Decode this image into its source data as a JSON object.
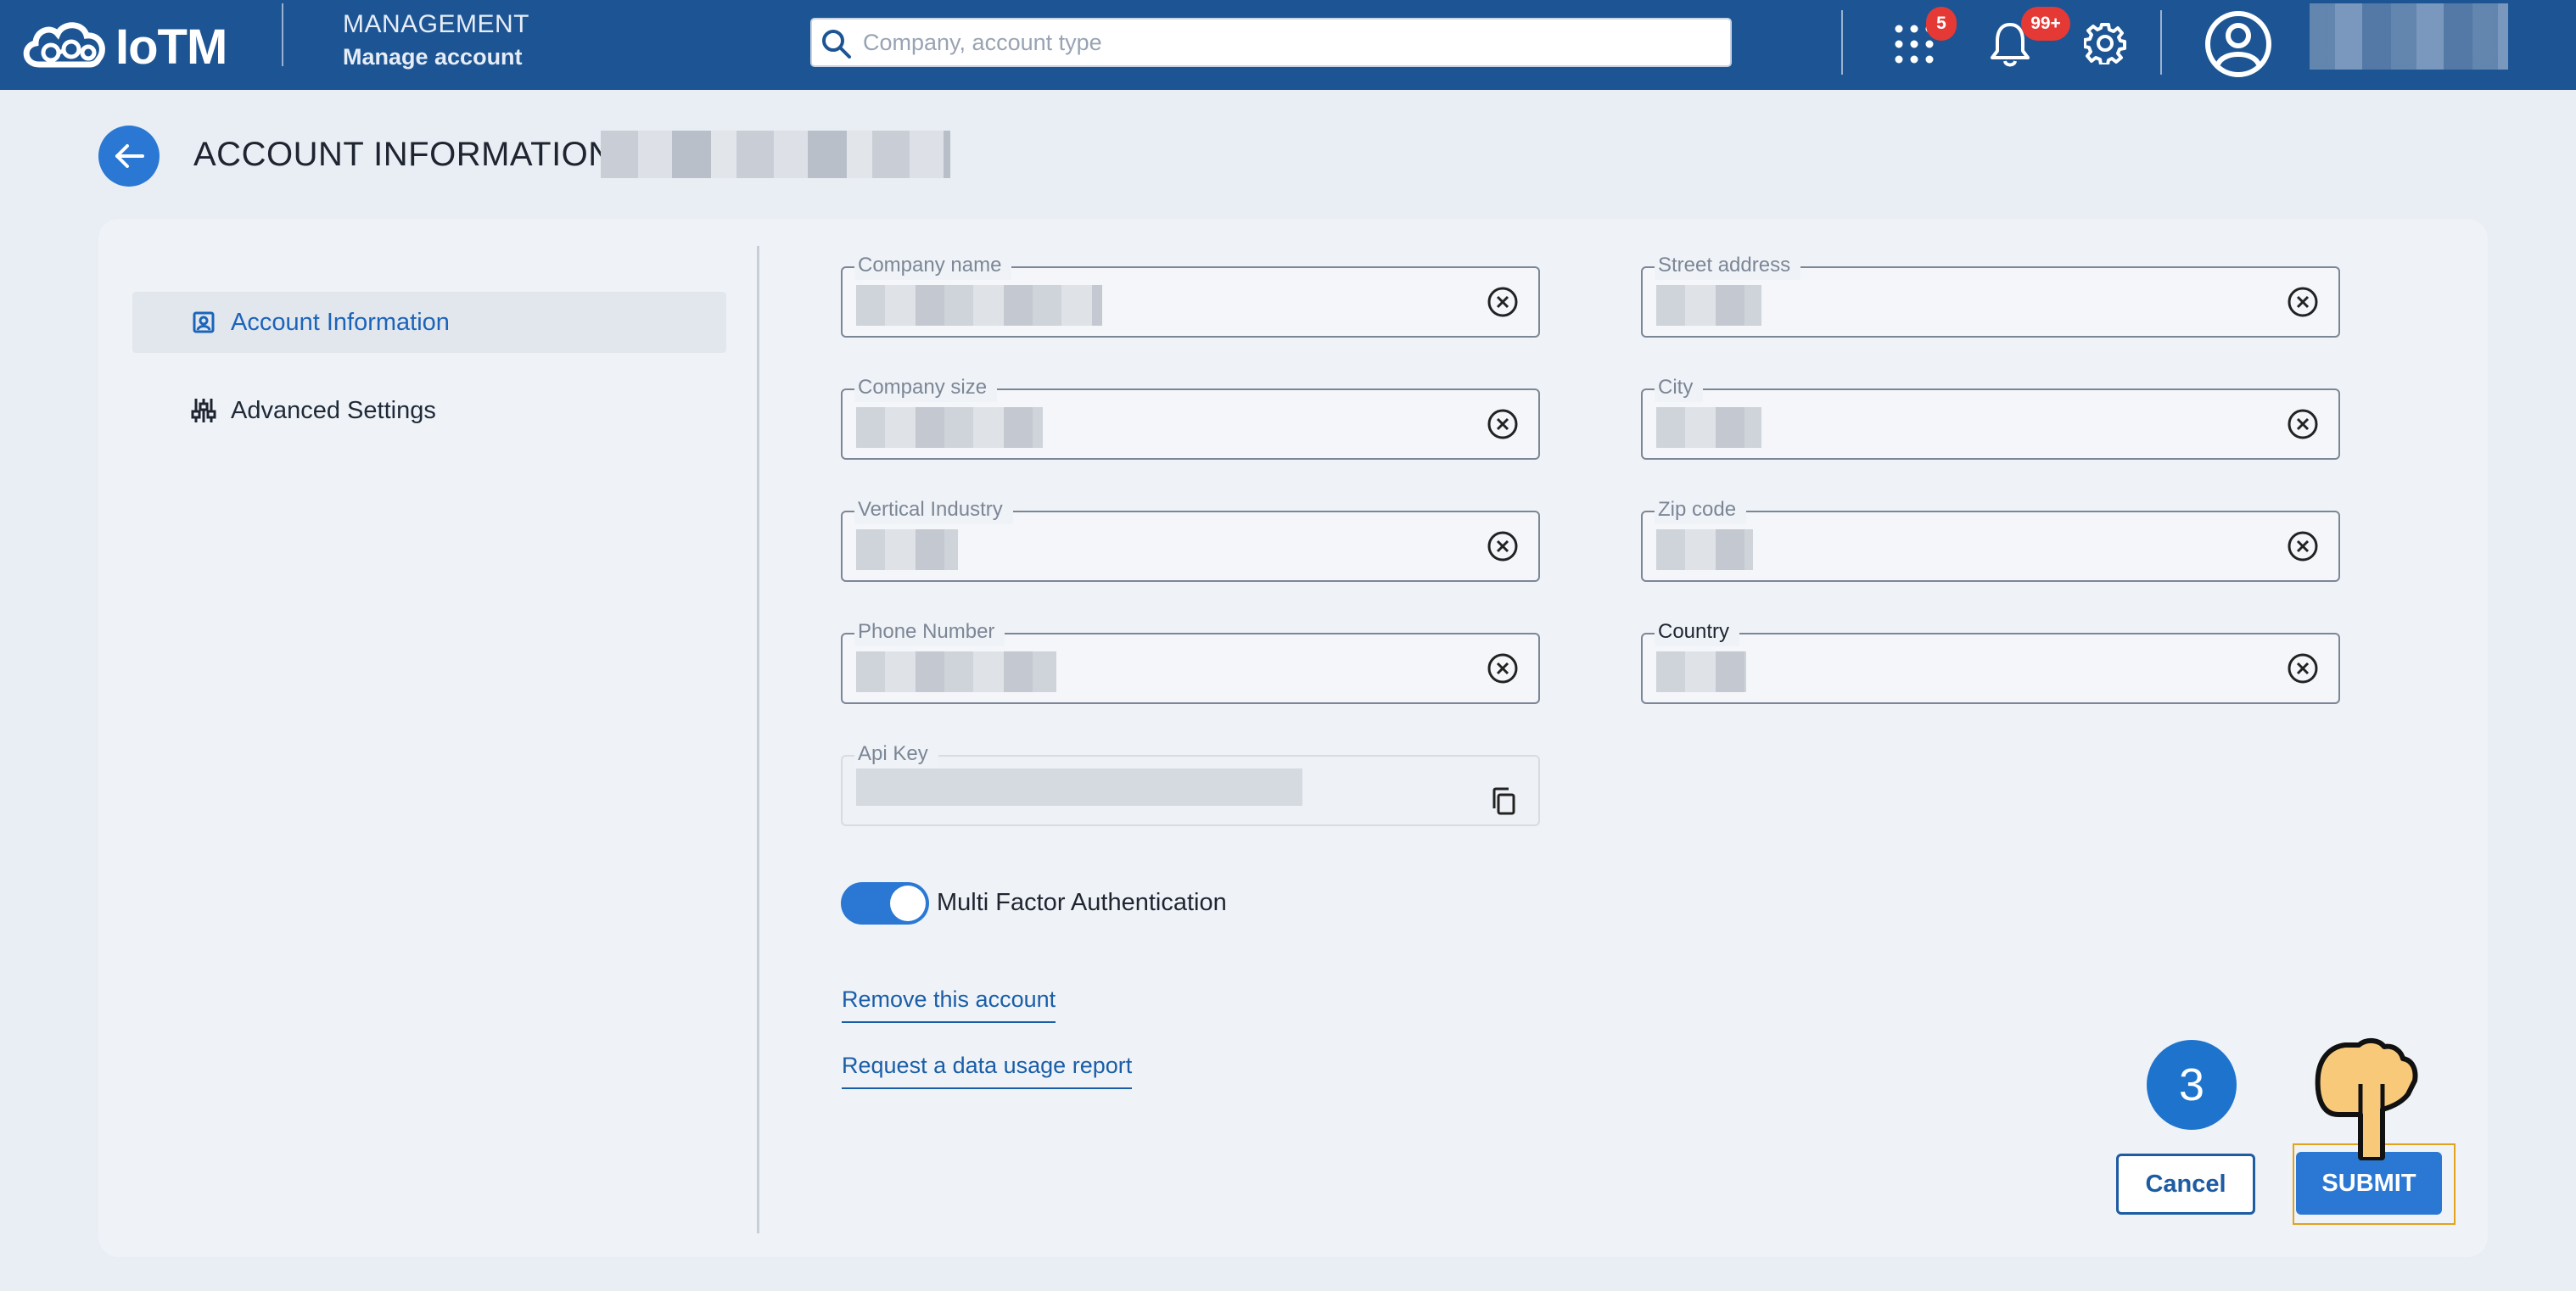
{
  "topbar": {
    "logo_text": "IoTM",
    "section_title": "MANAGEMENT",
    "section_subtitle": "Manage account",
    "search_placeholder": "Company, account type",
    "apps_badge": "5",
    "notifications_badge": "99+"
  },
  "header": {
    "title": "ACCOUNT INFORMATION"
  },
  "sidebar": {
    "items": [
      {
        "label": "Account Information",
        "active": true
      },
      {
        "label": "Advanced Settings",
        "active": false
      }
    ]
  },
  "form": {
    "left": [
      {
        "label": "Company name"
      },
      {
        "label": "Company size"
      },
      {
        "label": "Vertical Industry"
      },
      {
        "label": "Phone Number"
      },
      {
        "label": "Api Key"
      }
    ],
    "right": [
      {
        "label": "Street address"
      },
      {
        "label": "City"
      },
      {
        "label": "Zip code"
      },
      {
        "label": "Country"
      }
    ],
    "mfa_label": "Multi Factor Authentication",
    "mfa_enabled": true,
    "remove_link": "Remove this account",
    "report_link": "Request a data usage report"
  },
  "actions": {
    "step_number": "3",
    "cancel_label": "Cancel",
    "submit_label": "SUBMIT"
  },
  "colors": {
    "topbar": "#1d5594",
    "primary": "#2a78d3",
    "badge": "#e53935",
    "highlight": "#e3a21a"
  }
}
